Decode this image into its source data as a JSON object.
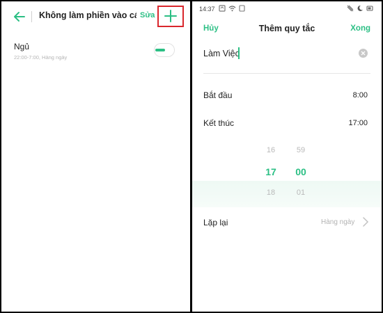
{
  "left": {
    "header": {
      "title": "Không làm phiền vào cá...",
      "edit_label": "Sửa"
    },
    "items": [
      {
        "name": "Ngủ",
        "schedule": "22:00-7:00, Hàng ngày",
        "enabled": true
      }
    ]
  },
  "right": {
    "status": {
      "time": "14:37"
    },
    "header": {
      "cancel_label": "Hủy",
      "title": "Thêm quy tắc",
      "done_label": "Xong"
    },
    "rule_name": {
      "value": "Làm Việc"
    },
    "start": {
      "label": "Bắt đầu",
      "value": "8:00"
    },
    "end": {
      "label": "Kết thúc",
      "value": "17:00"
    },
    "picker": {
      "hours": {
        "prev": "16",
        "selected": "17",
        "next": "18"
      },
      "minutes": {
        "prev": "59",
        "selected": "00",
        "next": "01"
      }
    },
    "repeat": {
      "label": "Lặp lại",
      "value": "Hàng ngày"
    }
  },
  "colors": {
    "accent": "#2bbf84",
    "highlight_box": "#d9262c"
  },
  "icons": [
    "back-arrow-icon",
    "plus-icon",
    "clear-icon",
    "chevron-right-icon",
    "wifi-icon",
    "vibrate-icon",
    "moon-icon"
  ]
}
